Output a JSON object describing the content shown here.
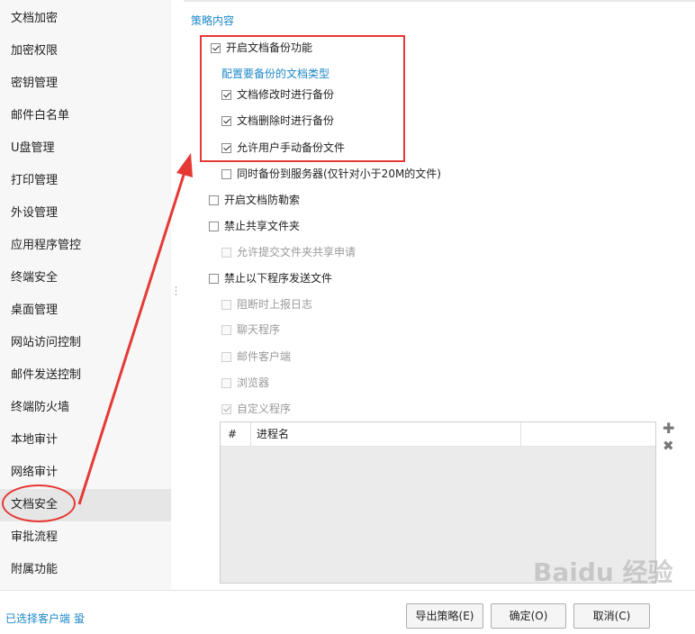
{
  "sidebar": {
    "items": [
      {
        "label": "文档加密"
      },
      {
        "label": "加密权限"
      },
      {
        "label": "密钥管理"
      },
      {
        "label": "邮件白名单"
      },
      {
        "label": "U盘管理"
      },
      {
        "label": "打印管理"
      },
      {
        "label": "外设管理"
      },
      {
        "label": "应用程序管控"
      },
      {
        "label": "终端安全"
      },
      {
        "label": "桌面管理"
      },
      {
        "label": "网站访问控制"
      },
      {
        "label": "邮件发送控制"
      },
      {
        "label": "终端防火墙"
      },
      {
        "label": "本地审计"
      },
      {
        "label": "网络审计"
      },
      {
        "label": "文档安全"
      },
      {
        "label": "审批流程"
      },
      {
        "label": "附属功能"
      }
    ],
    "active_label": "文档安全"
  },
  "policy": {
    "section_title": "策略内容",
    "enable_backup": "开启文档备份功能",
    "configure_types_link": "配置要备份的文档类型",
    "backup_on_modify": "文档修改时进行备份",
    "backup_on_delete": "文档删除时进行备份",
    "allow_manual_backup": "允许用户手动备份文件",
    "sync_to_server": "同时备份到服务器(仅针对小于20M的文件)",
    "anti_ransom": "开启文档防勒索",
    "forbid_shared_folder": "禁止共享文件夹",
    "allow_share_request": "允许提交文件夹共享申请",
    "forbid_program_send": "禁止以下程序发送文件",
    "log_on_block": "阻断时上报日志",
    "chat_programs": "聊天程序",
    "mail_clients": "邮件客户端",
    "browsers": "浏览器",
    "custom_programs": "自定义程序"
  },
  "process_table": {
    "columns": [
      "#",
      "进程名"
    ],
    "rows": []
  },
  "footer": {
    "selected_clients": "已选择客户端 蛩",
    "export_button": "导出策略(E)",
    "ok_button": "确定(O)",
    "cancel_button": "取消(C)"
  },
  "watermark": {
    "text": "Baidu 经验"
  },
  "colors": {
    "accent": "#1e88c8",
    "annotation": "#e53935",
    "active_item_bg": "#e6e6e6"
  }
}
